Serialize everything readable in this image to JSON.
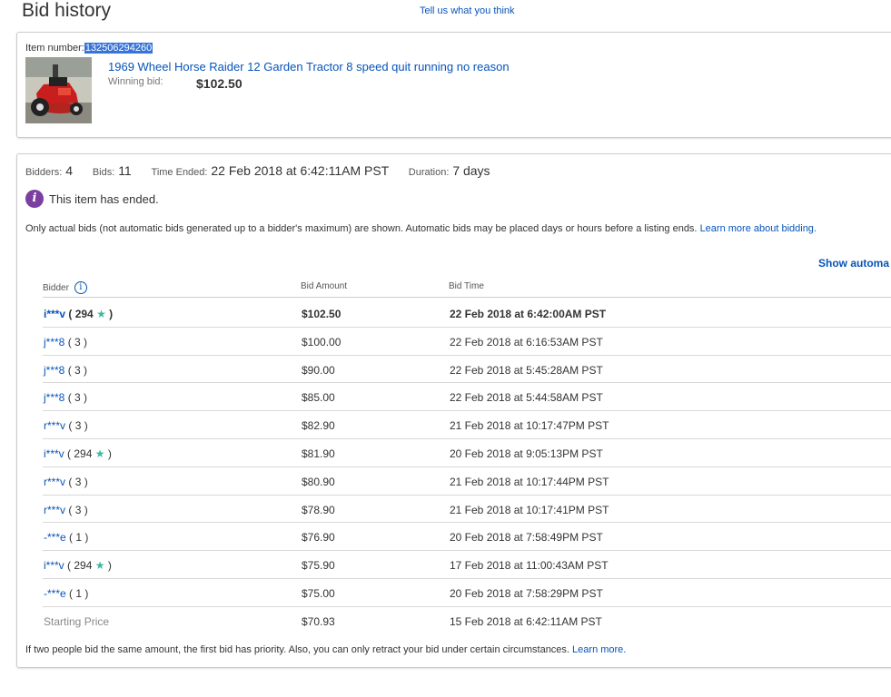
{
  "header": {
    "title": "Bid history",
    "feedback_link": "Tell us what you think"
  },
  "item": {
    "number_label": "Item number:",
    "number_value": "132506294260",
    "title": "1969 Wheel Horse Raider 12 Garden Tractor 8 speed quit running no reason",
    "winning_bid_label": "Winning bid:",
    "winning_bid_value": "$102.50"
  },
  "summary": {
    "bidders_label": "Bidders:",
    "bidders_value": "4",
    "bids_label": "Bids:",
    "bids_value": "11",
    "time_ended_label": "Time Ended:",
    "time_ended_value": "22 Feb 2018 at 6:42:11AM PST",
    "duration_label": "Duration:",
    "duration_value": "7 days"
  },
  "ended": {
    "icon": "info-icon",
    "text": "This item has ended."
  },
  "note": {
    "text": "Only actual bids (not automatic bids generated up to a bidder's maximum) are shown. Automatic bids may be placed days or hours before a listing ends. ",
    "link": "Learn more about bidding."
  },
  "show_automatic_label": "Show automa",
  "table": {
    "headers": {
      "bidder": "Bidder",
      "amount": "Bid Amount",
      "time": "Bid Time"
    },
    "rows": [
      {
        "bidder": "i***v",
        "feedback": "294",
        "star": true,
        "amount": "$102.50",
        "time": "22 Feb 2018 at 6:42:00AM PST"
      },
      {
        "bidder": "j***8",
        "feedback": "3",
        "star": false,
        "amount": "$100.00",
        "time": "22 Feb 2018 at 6:16:53AM PST"
      },
      {
        "bidder": "j***8",
        "feedback": "3",
        "star": false,
        "amount": "$90.00",
        "time": "22 Feb 2018 at 5:45:28AM PST"
      },
      {
        "bidder": "j***8",
        "feedback": "3",
        "star": false,
        "amount": "$85.00",
        "time": "22 Feb 2018 at 5:44:58AM PST"
      },
      {
        "bidder": "r***v",
        "feedback": "3",
        "star": false,
        "amount": "$82.90",
        "time": "21 Feb 2018 at 10:17:47PM PST"
      },
      {
        "bidder": "i***v",
        "feedback": "294",
        "star": true,
        "amount": "$81.90",
        "time": "20 Feb 2018 at 9:05:13PM PST"
      },
      {
        "bidder": "r***v",
        "feedback": "3",
        "star": false,
        "amount": "$80.90",
        "time": "21 Feb 2018 at 10:17:44PM PST"
      },
      {
        "bidder": "r***v",
        "feedback": "3",
        "star": false,
        "amount": "$78.90",
        "time": "21 Feb 2018 at 10:17:41PM PST"
      },
      {
        "bidder": "-***e",
        "feedback": "1",
        "star": false,
        "amount": "$76.90",
        "time": "20 Feb 2018 at 7:58:49PM PST"
      },
      {
        "bidder": "i***v",
        "feedback": "294",
        "star": true,
        "amount": "$75.90",
        "time": "17 Feb 2018 at 11:00:43AM PST"
      },
      {
        "bidder": "-***e",
        "feedback": "1",
        "star": false,
        "amount": "$75.00",
        "time": "20 Feb 2018 at 7:58:29PM PST"
      }
    ],
    "starting_price": {
      "label": "Starting Price",
      "amount": "$70.93",
      "time": "15 Feb 2018 at 6:42:11AM PST"
    }
  },
  "footnote": {
    "text": "If two people bid the same amount, the first bid has priority. Also, you can only retract your bid under certain circumstances. ",
    "link": "Learn more."
  },
  "colors": {
    "link": "#0654ba",
    "selection": "#3874d8",
    "ended_icon": "#7b3fa0",
    "star": "#3bb7a3"
  }
}
